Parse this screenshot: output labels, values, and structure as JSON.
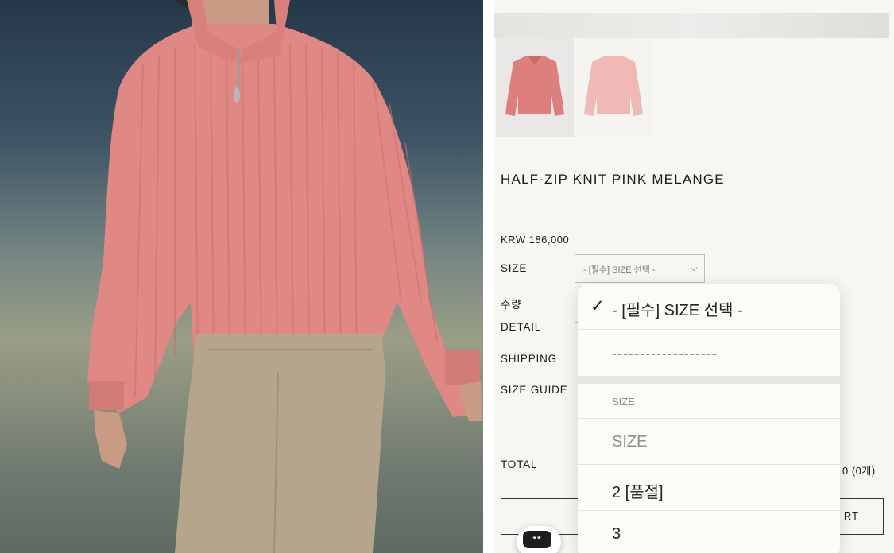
{
  "product": {
    "title": "HALF-ZIP KNIT PINK MELANGE",
    "price": "KRW 186,000"
  },
  "labels": {
    "size": "SIZE",
    "quantity": "수량",
    "detail": "DETAIL",
    "shipping": "SHIPPING",
    "size_guide": "SIZE GUIDE",
    "total": "TOTAL"
  },
  "size_select": {
    "value": "- [필수] SIZE 선택 -"
  },
  "total": {
    "value": "0 (0개)"
  },
  "cart_button": {
    "label_fragment": "RT"
  },
  "dropdown": {
    "selected_check": "✓",
    "options": [
      {
        "label": "- [필수] SIZE 선택 -"
      },
      {
        "label": "-------------------"
      },
      {
        "label": "SIZE"
      },
      {
        "label": "SIZE"
      },
      {
        "label": "2 [품절]"
      },
      {
        "label": "3"
      }
    ]
  },
  "chat": {
    "icon_text": "**"
  },
  "colors": {
    "background": "#f7f6f0",
    "sweater_pink": "#e08884",
    "pants_beige": "#b5a58d",
    "text": "#1b1b1b"
  }
}
